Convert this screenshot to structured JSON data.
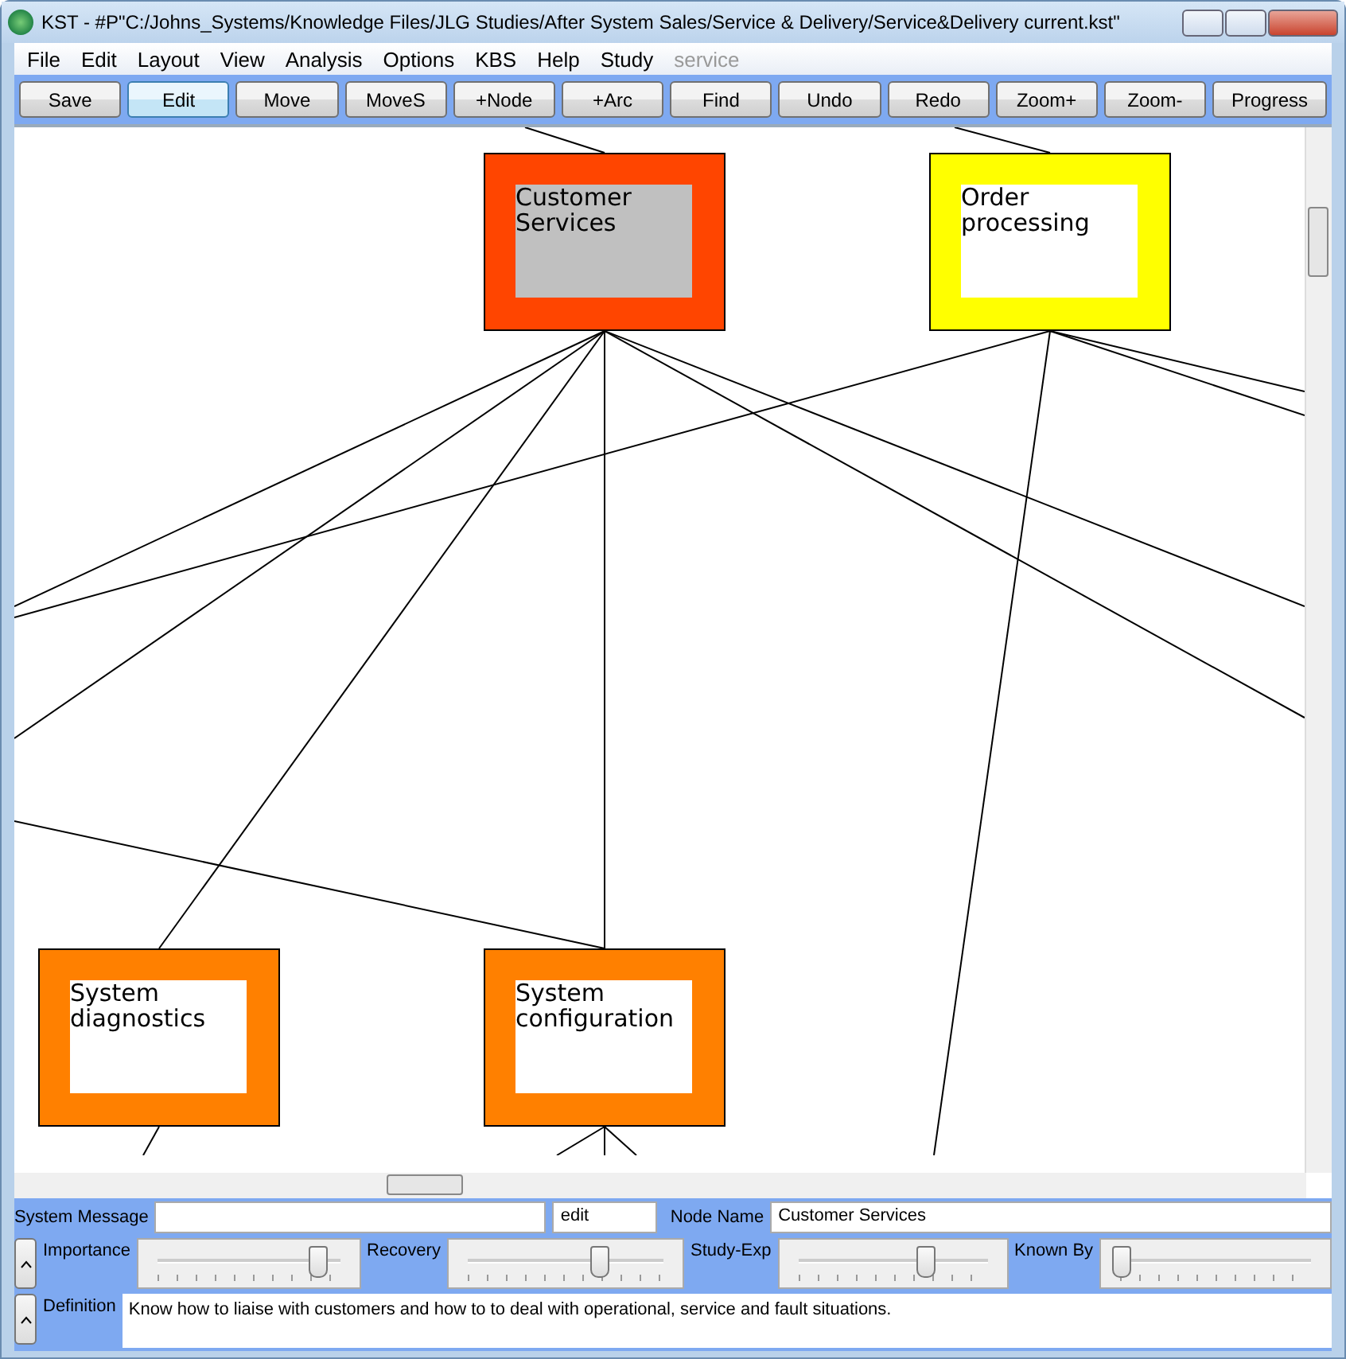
{
  "window": {
    "title": "KST - #P\"C:/Johns_Systems/Knowledge Files/JLG Studies/After System Sales/Service & Delivery/Service&Delivery current.kst\""
  },
  "menu": [
    {
      "label": "File",
      "disabled": false
    },
    {
      "label": "Edit",
      "disabled": false
    },
    {
      "label": "Layout",
      "disabled": false
    },
    {
      "label": "View",
      "disabled": false
    },
    {
      "label": "Analysis",
      "disabled": false
    },
    {
      "label": "Options",
      "disabled": false
    },
    {
      "label": "KBS",
      "disabled": false
    },
    {
      "label": "Help",
      "disabled": false
    },
    {
      "label": "Study",
      "disabled": false
    },
    {
      "label": "service",
      "disabled": true
    }
  ],
  "toolbar": [
    {
      "label": "Save",
      "selected": false
    },
    {
      "label": "Edit",
      "selected": true
    },
    {
      "label": "Move",
      "selected": false
    },
    {
      "label": "MoveS",
      "selected": false
    },
    {
      "label": "+Node",
      "selected": false
    },
    {
      "label": "+Arc",
      "selected": false
    },
    {
      "label": "Find",
      "selected": false
    },
    {
      "label": "Undo",
      "selected": false
    },
    {
      "label": "Redo",
      "selected": false
    },
    {
      "label": "Zoom+",
      "selected": false
    },
    {
      "label": "Zoom-",
      "selected": false
    },
    {
      "label": "Progress",
      "selected": false
    }
  ],
  "nodes": [
    {
      "label": "Customer Services",
      "color": "#ff4500",
      "selected": true
    },
    {
      "label": "Order processing",
      "color": "#ffff00",
      "selected": false
    },
    {
      "label": "System diagnostics",
      "color": "#ff8000",
      "selected": false
    },
    {
      "label": "System configuration",
      "color": "#ff8000",
      "selected": false
    }
  ],
  "panel": {
    "system_message_label": "System Message",
    "mode": "edit",
    "node_name_label": "Node Name",
    "node_name": "Customer Services",
    "definition_label": "Definition",
    "definition": "Know how to liaise with customers and how to to deal with operational, service and fault situations."
  },
  "sliders": [
    {
      "label": "Importance",
      "level": 0.87
    },
    {
      "label": "Recovery",
      "level": 0.67
    },
    {
      "label": "Study-Exp",
      "level": 0.67
    },
    {
      "label": "Known By",
      "level": 0
    }
  ]
}
